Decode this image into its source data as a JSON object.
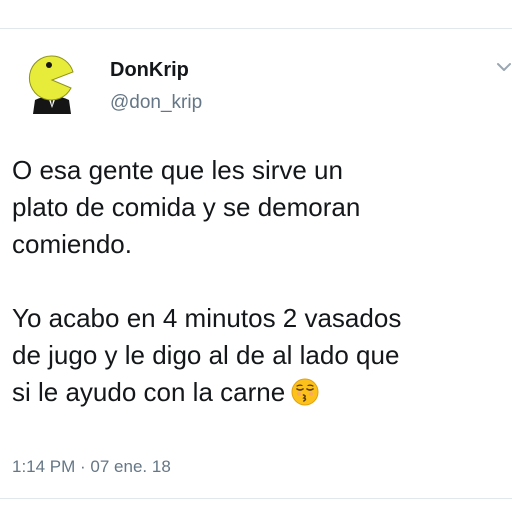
{
  "tweet": {
    "display_name": "DonKrip",
    "handle": "@don_krip",
    "lines": [
      "O esa gente que les sirve un",
      "plato de comida y se demoran",
      "comiendo.",
      "",
      "Yo acabo en 4 minutos 2 vasados",
      "de jugo y le digo al de al lado que",
      "si le ayudo con la carne"
    ],
    "timestamp": "1:14 PM · 07 ene. 18"
  },
  "icons": {
    "avatar": "pacman-suit-avatar-icon",
    "caret": "chevron-down-icon",
    "emoji": "kissing-face-emoji-icon"
  },
  "colors": {
    "text_primary": "#14171a",
    "text_secondary": "#657786",
    "divider": "#e1e8ed",
    "avatar_yellow": "#e7ec3a"
  }
}
